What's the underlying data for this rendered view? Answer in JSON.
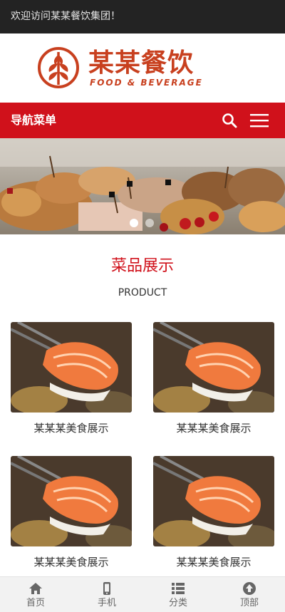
{
  "topbar": {
    "welcome": "欢迎访问某某餐饮集团！"
  },
  "header": {
    "logo_cn": "某某餐饮",
    "logo_en": "FOOD & BEVERAGE"
  },
  "nav": {
    "title": "导航菜单",
    "search_icon": "search-icon",
    "menu_icon": "hamburger-menu-icon"
  },
  "banner": {
    "slides": 2,
    "active_slide": 1
  },
  "section": {
    "title": "菜品展示",
    "subtitle": "PRODUCT",
    "products": [
      {
        "caption": "某某某美食展示"
      },
      {
        "caption": "某某某美食展示"
      },
      {
        "caption": "某某某美食展示"
      },
      {
        "caption": "某某某美食展示"
      }
    ]
  },
  "bottom_nav": [
    {
      "label": "首页",
      "icon": "home-icon"
    },
    {
      "label": "手机",
      "icon": "mobile-icon"
    },
    {
      "label": "分类",
      "icon": "list-icon"
    },
    {
      "label": "顶部",
      "icon": "arrow-up-circle-icon"
    }
  ],
  "colors": {
    "brand_red": "#d0111b",
    "logo_orange": "#c8401f",
    "topbar_bg": "#232323"
  }
}
